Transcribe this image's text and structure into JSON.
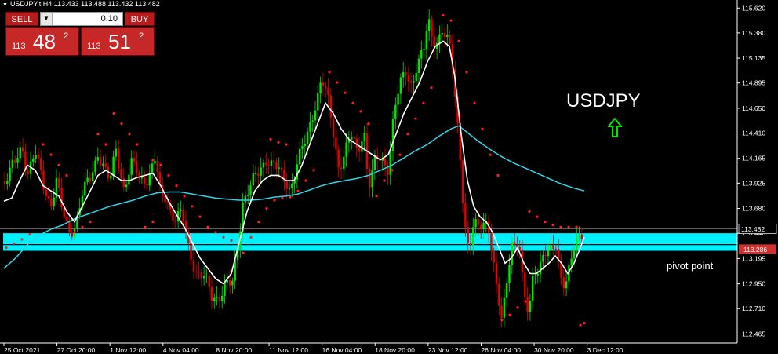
{
  "header": {
    "text": "USDJPY.t,H4  113.433 113.488 113.432 113.482"
  },
  "trade_panel": {
    "sell_label": "SELL",
    "buy_label": "BUY",
    "lot_value": "0.10",
    "sell_price": {
      "prefix": "113",
      "main": "48",
      "sup": "2"
    },
    "buy_price": {
      "prefix": "113",
      "main": "51",
      "sup": "2"
    }
  },
  "annotations": {
    "symbol": "USDJPY",
    "pivot_label": "pivot point"
  },
  "colors": {
    "bull": "#00e600",
    "bear": "#e60000",
    "ma_fast": "#ffffff",
    "ma_slow": "#2fd5e6",
    "sar": "#ff2020",
    "zone": "#00f0ff",
    "arrow": "#00e600"
  },
  "chart_data": {
    "type": "candlestick",
    "title": "USDJPY.t,H4",
    "ylim": [
      112.4,
      115.66
    ],
    "y_ticks": [
      "115.620",
      "115.380",
      "115.135",
      "114.895",
      "114.650",
      "114.410",
      "114.165",
      "113.925",
      "113.680",
      "113.440",
      "113.195",
      "112.950",
      "112.710",
      "112.465"
    ],
    "x_ticks": [
      "25 Oct 2021",
      "27 Oct 20:00",
      "1 Nov 12:00",
      "4 Nov 04:00",
      "8 Nov 20:00",
      "11 Nov 12:00",
      "16 Nov 04:00",
      "18 Nov 20:00",
      "23 Nov 12:00",
      "26 Nov 04:00",
      "30 Nov 20:00",
      "3 Dec 12:00"
    ],
    "current_price": "113.482",
    "pivot_price": "113.286",
    "pivot_zone": [
      113.27,
      113.44
    ],
    "close_path": [
      [
        0,
        113.9
      ],
      [
        10,
        114.0
      ],
      [
        20,
        114.1
      ],
      [
        28,
        114.3
      ],
      [
        35,
        114.05
      ],
      [
        45,
        114.2
      ],
      [
        55,
        113.9
      ],
      [
        65,
        113.75
      ],
      [
        72,
        113.95
      ],
      [
        80,
        113.6
      ],
      [
        88,
        113.45
      ],
      [
        96,
        113.55
      ],
      [
        105,
        113.8
      ],
      [
        115,
        113.95
      ],
      [
        125,
        114.25
      ],
      [
        132,
        114.1
      ],
      [
        140,
        113.9
      ],
      [
        148,
        114.25
      ],
      [
        158,
        113.9
      ],
      [
        168,
        114.1
      ],
      [
        178,
        113.95
      ],
      [
        188,
        114.0
      ],
      [
        198,
        114.15
      ],
      [
        205,
        113.75
      ],
      [
        212,
        113.8
      ],
      [
        222,
        113.6
      ],
      [
        232,
        113.6
      ],
      [
        240,
        113.3
      ],
      [
        250,
        113.1
      ],
      [
        260,
        113.0
      ],
      [
        270,
        112.8
      ],
      [
        278,
        112.85
      ],
      [
        288,
        112.95
      ],
      [
        296,
        112.9
      ],
      [
        303,
        113.3
      ],
      [
        310,
        113.8
      ],
      [
        320,
        113.9
      ],
      [
        330,
        114.0
      ],
      [
        340,
        114.2
      ],
      [
        350,
        114.1
      ],
      [
        360,
        113.95
      ],
      [
        370,
        113.9
      ],
      [
        380,
        114.15
      ],
      [
        390,
        114.3
      ],
      [
        400,
        114.65
      ],
      [
        410,
        114.95
      ],
      [
        418,
        114.7
      ],
      [
        425,
        114.4
      ],
      [
        432,
        114.1
      ],
      [
        440,
        114.25
      ],
      [
        448,
        114.35
      ],
      [
        456,
        114.2
      ],
      [
        464,
        114.5
      ],
      [
        470,
        113.9
      ],
      [
        478,
        114.1
      ],
      [
        486,
        114.15
      ],
      [
        495,
        114.1
      ],
      [
        502,
        114.6
      ],
      [
        510,
        114.85
      ],
      [
        518,
        115.0
      ],
      [
        525,
        114.9
      ],
      [
        532,
        115.1
      ],
      [
        540,
        115.15
      ],
      [
        546,
        115.5
      ],
      [
        552,
        115.3
      ],
      [
        558,
        115.35
      ],
      [
        564,
        115.4
      ],
      [
        572,
        115.25
      ],
      [
        576,
        115.1
      ],
      [
        580,
        114.8
      ],
      [
        586,
        114.3
      ],
      [
        592,
        113.6
      ],
      [
        598,
        113.2
      ],
      [
        604,
        113.5
      ],
      [
        610,
        113.5
      ],
      [
        616,
        113.6
      ],
      [
        622,
        113.55
      ],
      [
        628,
        113.2
      ],
      [
        634,
        112.8
      ],
      [
        640,
        112.6
      ],
      [
        646,
        113.0
      ],
      [
        652,
        113.4
      ],
      [
        656,
        113.3
      ],
      [
        662,
        113.3
      ],
      [
        668,
        112.8
      ],
      [
        674,
        112.7
      ],
      [
        680,
        113.1
      ],
      [
        688,
        113.1
      ],
      [
        696,
        113.2
      ],
      [
        704,
        113.3
      ],
      [
        710,
        113.4
      ],
      [
        714,
        113.05
      ],
      [
        720,
        112.9
      ],
      [
        728,
        113.1
      ],
      [
        734,
        113.4
      ],
      [
        740,
        113.45
      ],
      [
        745,
        113.48
      ]
    ],
    "ma_fast": [
      [
        5,
        113.75
      ],
      [
        15,
        113.78
      ],
      [
        25,
        113.95
      ],
      [
        35,
        114.1
      ],
      [
        45,
        114.05
      ],
      [
        55,
        113.9
      ],
      [
        65,
        113.85
      ],
      [
        75,
        113.8
      ],
      [
        85,
        113.65
      ],
      [
        95,
        113.55
      ],
      [
        105,
        113.7
      ],
      [
        115,
        113.85
      ],
      [
        125,
        114.0
      ],
      [
        135,
        114.05
      ],
      [
        145,
        114.0
      ],
      [
        155,
        113.95
      ],
      [
        165,
        113.95
      ],
      [
        175,
        113.98
      ],
      [
        185,
        114.0
      ],
      [
        195,
        114.02
      ],
      [
        205,
        113.9
      ],
      [
        215,
        113.75
      ],
      [
        225,
        113.62
      ],
      [
        235,
        113.5
      ],
      [
        245,
        113.35
      ],
      [
        255,
        113.2
      ],
      [
        265,
        113.1
      ],
      [
        275,
        113.0
      ],
      [
        285,
        112.95
      ],
      [
        295,
        113.05
      ],
      [
        305,
        113.35
      ],
      [
        315,
        113.65
      ],
      [
        325,
        113.85
      ],
      [
        335,
        113.95
      ],
      [
        345,
        114.0
      ],
      [
        355,
        114.0
      ],
      [
        365,
        113.95
      ],
      [
        375,
        113.95
      ],
      [
        385,
        114.1
      ],
      [
        395,
        114.3
      ],
      [
        405,
        114.5
      ],
      [
        415,
        114.7
      ],
      [
        425,
        114.6
      ],
      [
        435,
        114.45
      ],
      [
        445,
        114.35
      ],
      [
        455,
        114.3
      ],
      [
        465,
        114.25
      ],
      [
        475,
        114.2
      ],
      [
        485,
        114.15
      ],
      [
        495,
        114.2
      ],
      [
        505,
        114.4
      ],
      [
        515,
        114.6
      ],
      [
        525,
        114.75
      ],
      [
        535,
        114.9
      ],
      [
        545,
        115.1
      ],
      [
        555,
        115.25
      ],
      [
        565,
        115.3
      ],
      [
        573,
        115.25
      ],
      [
        580,
        114.95
      ],
      [
        588,
        114.4
      ],
      [
        596,
        113.95
      ],
      [
        604,
        113.7
      ],
      [
        612,
        113.6
      ],
      [
        620,
        113.55
      ],
      [
        628,
        113.45
      ],
      [
        636,
        113.3
      ],
      [
        644,
        113.15
      ],
      [
        652,
        113.2
      ],
      [
        660,
        113.3
      ],
      [
        668,
        113.15
      ],
      [
        676,
        113.05
      ],
      [
        684,
        113.05
      ],
      [
        692,
        113.1
      ],
      [
        700,
        113.15
      ],
      [
        708,
        113.22
      ],
      [
        716,
        113.15
      ],
      [
        724,
        113.05
      ],
      [
        732,
        113.15
      ],
      [
        740,
        113.3
      ],
      [
        745,
        113.4
      ]
    ],
    "ma_slow": [
      [
        5,
        113.1
      ],
      [
        20,
        113.2
      ],
      [
        35,
        113.33
      ],
      [
        50,
        113.42
      ],
      [
        65,
        113.48
      ],
      [
        80,
        113.52
      ],
      [
        95,
        113.58
      ],
      [
        110,
        113.62
      ],
      [
        125,
        113.66
      ],
      [
        140,
        113.7
      ],
      [
        155,
        113.73
      ],
      [
        170,
        113.76
      ],
      [
        185,
        113.8
      ],
      [
        200,
        113.83
      ],
      [
        215,
        113.84
      ],
      [
        230,
        113.84
      ],
      [
        245,
        113.82
      ],
      [
        260,
        113.8
      ],
      [
        275,
        113.78
      ],
      [
        290,
        113.77
      ],
      [
        305,
        113.76
      ],
      [
        320,
        113.76
      ],
      [
        335,
        113.77
      ],
      [
        350,
        113.79
      ],
      [
        365,
        113.8
      ],
      [
        380,
        113.82
      ],
      [
        395,
        113.86
      ],
      [
        410,
        113.9
      ],
      [
        425,
        113.93
      ],
      [
        440,
        113.95
      ],
      [
        455,
        113.97
      ],
      [
        470,
        114.0
      ],
      [
        485,
        114.05
      ],
      [
        500,
        114.1
      ],
      [
        515,
        114.17
      ],
      [
        530,
        114.24
      ],
      [
        545,
        114.3
      ],
      [
        560,
        114.38
      ],
      [
        575,
        114.45
      ],
      [
        585,
        114.48
      ],
      [
        595,
        114.42
      ],
      [
        610,
        114.33
      ],
      [
        625,
        114.25
      ],
      [
        640,
        114.18
      ],
      [
        655,
        114.12
      ],
      [
        670,
        114.07
      ],
      [
        685,
        114.02
      ],
      [
        700,
        113.97
      ],
      [
        715,
        113.92
      ],
      [
        730,
        113.88
      ],
      [
        745,
        113.85
      ]
    ],
    "sar_up": [
      [
        8,
        113.3
      ],
      [
        18,
        113.34
      ],
      [
        28,
        113.38
      ],
      [
        38,
        113.43
      ],
      [
        95,
        113.45
      ],
      [
        105,
        113.5
      ],
      [
        115,
        113.55
      ],
      [
        185,
        113.5
      ],
      [
        195,
        113.55
      ],
      [
        310,
        113.25
      ],
      [
        320,
        113.4
      ],
      [
        330,
        113.55
      ],
      [
        340,
        113.68
      ],
      [
        350,
        113.76
      ],
      [
        360,
        113.78
      ],
      [
        370,
        113.79
      ],
      [
        380,
        113.85
      ],
      [
        390,
        113.95
      ],
      [
        400,
        114.05
      ],
      [
        480,
        113.8
      ],
      [
        490,
        113.95
      ],
      [
        500,
        114.05
      ],
      [
        510,
        114.2
      ],
      [
        520,
        114.4
      ],
      [
        530,
        114.55
      ],
      [
        540,
        114.7
      ],
      [
        550,
        114.85
      ],
      [
        640,
        112.6
      ],
      [
        650,
        112.65
      ],
      [
        660,
        112.72
      ],
      [
        670,
        112.78
      ],
      [
        740,
        112.55
      ],
      [
        745,
        112.57
      ]
    ],
    "sar_down": [
      [
        55,
        114.3
      ],
      [
        65,
        114.2
      ],
      [
        75,
        114.1
      ],
      [
        85,
        114.0
      ],
      [
        125,
        114.4
      ],
      [
        135,
        114.3
      ],
      [
        145,
        114.6
      ],
      [
        155,
        114.5
      ],
      [
        165,
        114.4
      ],
      [
        175,
        114.3
      ],
      [
        195,
        114.15
      ],
      [
        205,
        114.1
      ],
      [
        215,
        114.0
      ],
      [
        225,
        113.9
      ],
      [
        235,
        113.8
      ],
      [
        245,
        113.7
      ],
      [
        255,
        113.6
      ],
      [
        265,
        113.5
      ],
      [
        275,
        113.45
      ],
      [
        285,
        113.4
      ],
      [
        295,
        113.37
      ],
      [
        345,
        114.35
      ],
      [
        355,
        114.32
      ],
      [
        365,
        114.3
      ],
      [
        420,
        115.0
      ],
      [
        430,
        114.9
      ],
      [
        440,
        114.8
      ],
      [
        450,
        114.7
      ],
      [
        460,
        114.62
      ],
      [
        470,
        114.5
      ],
      [
        565,
        115.55
      ],
      [
        575,
        115.5
      ],
      [
        585,
        115.3
      ],
      [
        595,
        115.0
      ],
      [
        605,
        114.7
      ],
      [
        615,
        114.45
      ],
      [
        625,
        114.2
      ],
      [
        635,
        114.0
      ],
      [
        675,
        113.65
      ],
      [
        685,
        113.6
      ],
      [
        695,
        113.55
      ],
      [
        705,
        113.52
      ],
      [
        715,
        113.5
      ],
      [
        725,
        113.5
      ],
      [
        735,
        113.5
      ]
    ]
  }
}
